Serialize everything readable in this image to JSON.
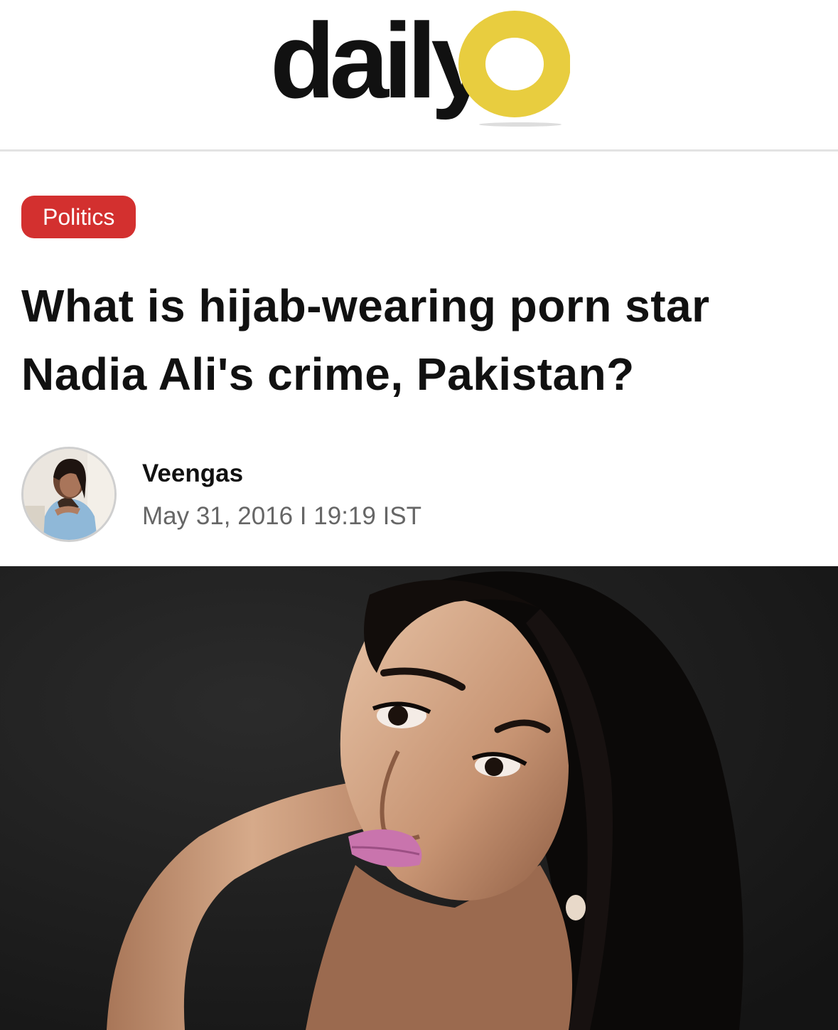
{
  "brand": {
    "logo_text": "daily",
    "accent_color": "#e8cd3f",
    "text_color": "#111111"
  },
  "article": {
    "category": "Politics",
    "category_color": "#d3302f",
    "title": "What is hijab-wearing porn star Nadia Ali's crime, Pakistan?",
    "author": {
      "name": "Veengas",
      "date": "May 31, 2016 I 19:19 IST"
    },
    "hero_image": {
      "icon": "photo-image"
    }
  }
}
